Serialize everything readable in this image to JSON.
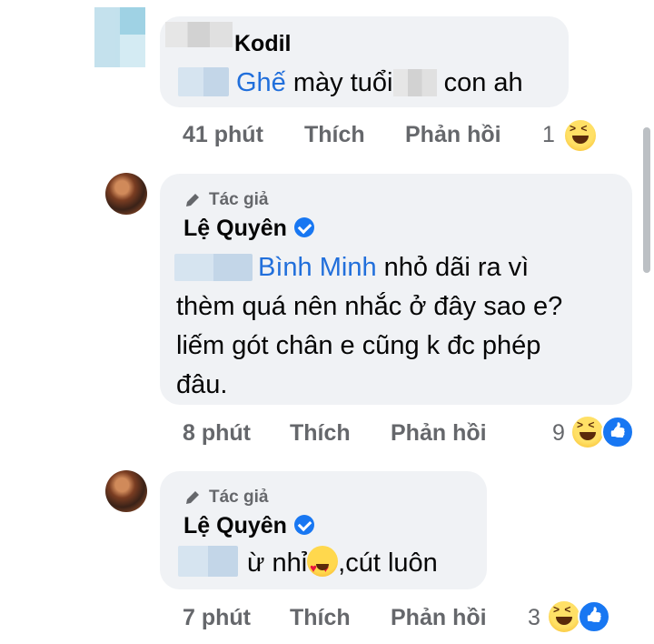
{
  "comments": [
    {
      "author": "Kodil",
      "mention": "Ghế",
      "text_parts": [
        "mày tuổi",
        "con ah"
      ],
      "time": "41 phút",
      "like_label": "Thích",
      "reply_label": "Phản hồi",
      "reaction_count": "1",
      "reactions": [
        "haha-icon"
      ]
    },
    {
      "badge": "Tác giả",
      "author": "Lệ Quyên",
      "verified": true,
      "mention": "Bình Minh",
      "lines": [
        " nhỏ dãi ra vì",
        "thèm quá nên nhắc ở đây sao e?",
        "liếm gót chân e cũng k đc phép",
        "đâu."
      ],
      "time": "8 phút",
      "like_label": "Thích",
      "reply_label": "Phản hồi",
      "reaction_count": "9",
      "reactions": [
        "haha-icon",
        "like-icon"
      ]
    },
    {
      "badge": "Tác giả",
      "author": "Lệ Quyên",
      "verified": true,
      "text_before": "ừ nhỉ",
      "text_after": ",cút luôn",
      "time": "7 phút",
      "like_label": "Thích",
      "reply_label": "Phản hồi",
      "reaction_count": "3",
      "reactions": [
        "haha-icon",
        "like-icon"
      ]
    }
  ],
  "colors": {
    "bubble": "#f0f2f5",
    "mention": "#216fdb",
    "meta": "#65676b",
    "verified": "#1877f2"
  }
}
